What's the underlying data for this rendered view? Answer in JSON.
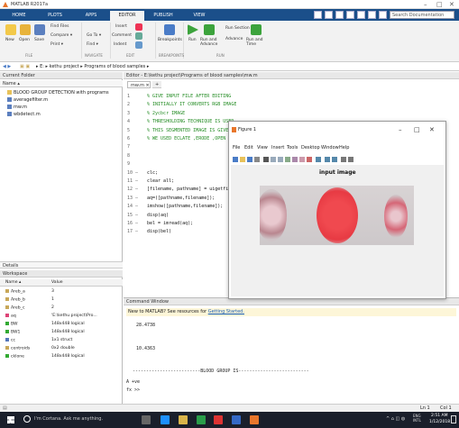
{
  "titlebar": {
    "title": "MATLAB R2017a",
    "min": "–",
    "max": "□",
    "close": "✕"
  },
  "tabs": [
    "HOME",
    "PLOTS",
    "APPS",
    "EDITOR",
    "PUBLISH",
    "VIEW"
  ],
  "search_placeholder": "Search Documentation",
  "ribbon": {
    "buttons": [
      "New",
      "Open",
      "Save",
      "Find Files",
      "Compare ▾",
      "Print ▾",
      "Go To ▾",
      "Find ▾",
      "Insert",
      "Comment",
      "Indent",
      "Breakpoints",
      "Run",
      "Run and Advance",
      "Run Section",
      "Advance",
      "Run and Time"
    ],
    "groups": [
      "FILE",
      "NAVIGATE",
      "EDIT",
      "BREAKPOINTS",
      "RUN"
    ]
  },
  "address": {
    "path": "▸ E: ▸ kethu project ▸ Programs of blood samples ▸"
  },
  "current_folder": {
    "title": "Current Folder",
    "col": "Name ▴",
    "items": [
      "BLOOD GROUP DETECTION with programs",
      "averagefilter.m",
      "mw.m",
      "wbdetect.m"
    ],
    "details": "Details"
  },
  "workspace": {
    "title": "Workspace",
    "cols": [
      "Name ▴",
      "Value"
    ],
    "rows": [
      {
        "name": "Areb_a",
        "value": "3"
      },
      {
        "name": "Areb_b",
        "value": "1"
      },
      {
        "name": "Areb_c",
        "value": "2"
      },
      {
        "name": "aq",
        "value": "'E:\\kethu project\\Pro..."
      },
      {
        "name": "BW",
        "value": "148x448 logical"
      },
      {
        "name": "BW1",
        "value": "148x448 logical"
      },
      {
        "name": "cc",
        "value": "1x1 struct"
      },
      {
        "name": "centroids",
        "value": "0x2 double"
      },
      {
        "name": "cklone",
        "value": "148x448 logical"
      }
    ]
  },
  "editor": {
    "title": "Editor - E:\\kethu project\\Programs of blood samples\\mw.m",
    "file_tab": "mw.m ✕",
    "add_tab": "+",
    "lines": [
      {
        "n": "1",
        "t": "% GIVE INPUT FILE AFTER EDITING"
      },
      {
        "n": "2",
        "t": "% INITIALLY IT CONVERTS RGB IMAGE"
      },
      {
        "n": "3",
        "t": "% 2ycbcr IMAGE"
      },
      {
        "n": "4",
        "t": "% THRESHOLDING TECHNIQUE IS USED"
      },
      {
        "n": "5",
        "t": "% THIS SEGMENTED IMAGE IS GIVEN"
      },
      {
        "n": "6",
        "t": "% WE USED ECLATE ,ERODE ,OPEN"
      },
      {
        "n": "7",
        "t": ""
      },
      {
        "n": "8",
        "t": ""
      },
      {
        "n": "9",
        "t": ""
      },
      {
        "n": "10 –",
        "t": "clc;"
      },
      {
        "n": "11 –",
        "t": "clear all;"
      },
      {
        "n": "12 –",
        "t": "[filename, pathname] = uigetfile"
      },
      {
        "n": "13 –",
        "t": "aq=([pathname,filename]);"
      },
      {
        "n": "14 –",
        "t": "imshow([pathname,filename]);"
      },
      {
        "n": "15 –",
        "t": "disp(aq)"
      },
      {
        "n": "16 –",
        "t": "bel = imread(aq);"
      },
      {
        "n": "17 –",
        "t": "disp(bel)"
      }
    ]
  },
  "command_window": {
    "title": "Command Window",
    "notice": "New to MATLAB? See resources for",
    "notice_link": "Getting Started.",
    "out1": "28.4738",
    "out2": "10.4363",
    "out3": "-------------------------BLOOD GROUP IS--------------------------",
    "out4": "A +ve",
    "prompt": "fx >>"
  },
  "figure": {
    "title": "Figure 1",
    "menus": [
      "File",
      "Edit",
      "View",
      "Insert",
      "Tools",
      "Desktop",
      "Window",
      "Help"
    ],
    "plot_title": "input image",
    "controls": {
      "min": "–",
      "max": "□",
      "close": "✕"
    }
  },
  "statusbar": {
    "ln": "Ln 1",
    "col": "Col 1"
  },
  "taskbar": {
    "cortana": "I'm Cortana. Ask me anything.",
    "time": "2:51 AM",
    "date": "1/12/2018",
    "lang": "ENG\nINTL"
  }
}
